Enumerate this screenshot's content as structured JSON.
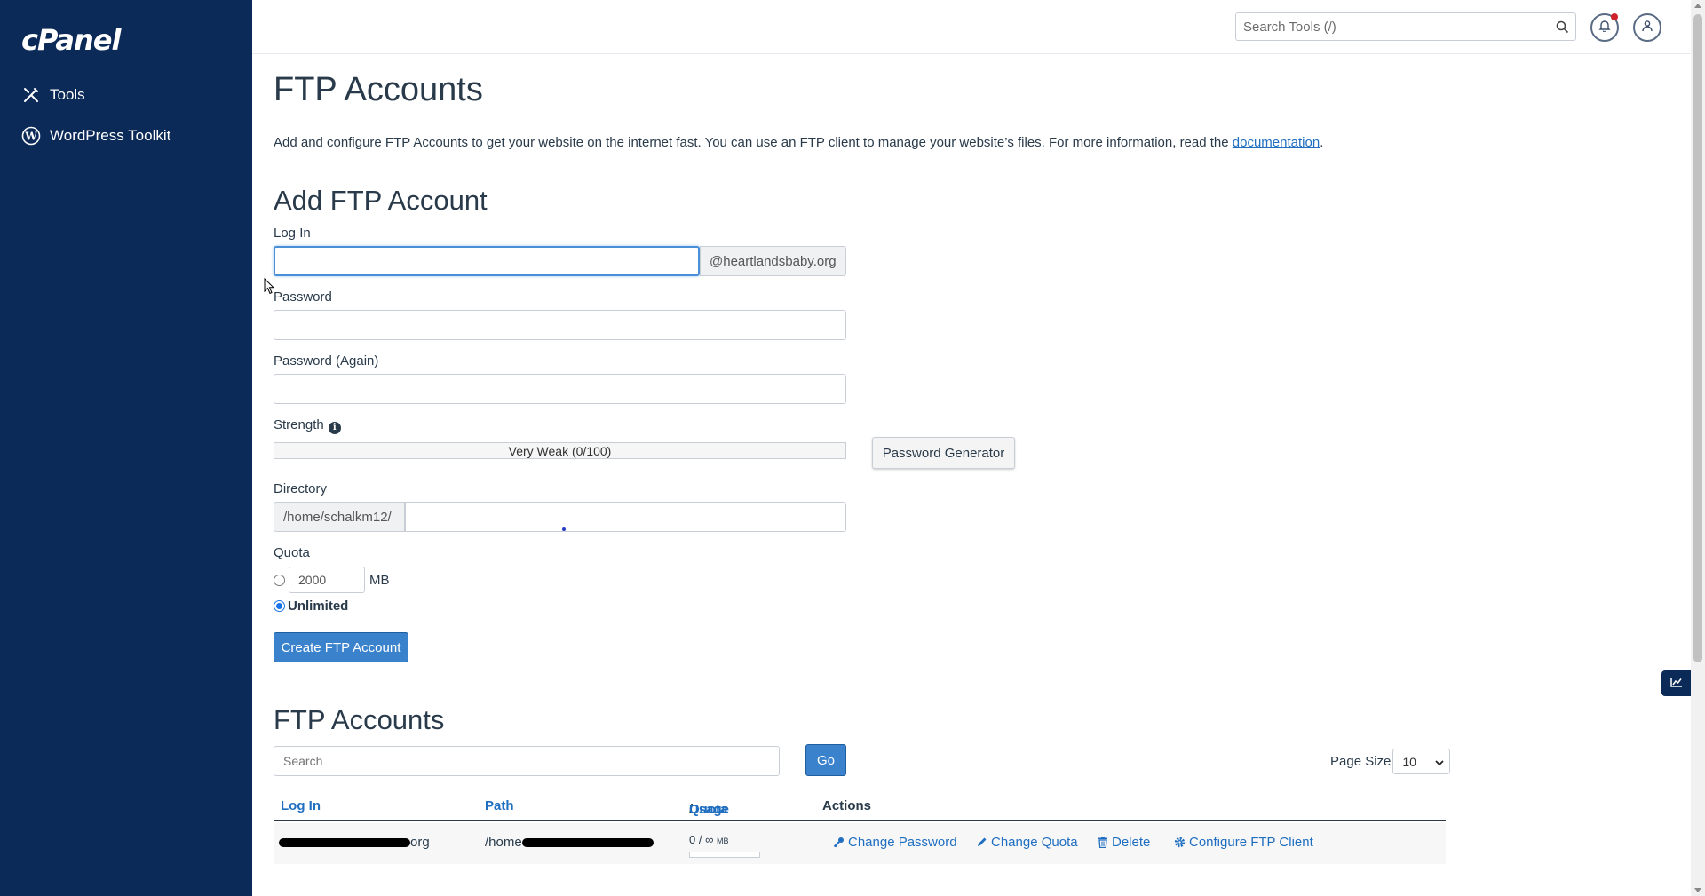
{
  "sidebar": {
    "logo": "cPanel",
    "items": [
      {
        "label": "Tools",
        "icon": "tools-icon"
      },
      {
        "label": "WordPress Toolkit",
        "icon": "wordpress-icon"
      }
    ]
  },
  "header": {
    "search_placeholder": "Search Tools (/)"
  },
  "page": {
    "title": "FTP Accounts",
    "intro": "Add and configure FTP Accounts to get your website on the internet fast. You can use an FTP client to manage your website’s files. For more information, read the ",
    "intro_link": "documentation",
    "intro_end": "."
  },
  "add_form": {
    "heading": "Add FTP Account",
    "login_label": "Log In",
    "login_value": "",
    "domain_suffix": "@heartlandsbaby.org",
    "password_label": "Password",
    "password_again_label": "Password (Again)",
    "strength_label": "Strength",
    "strength_text": "Very Weak (0/100)",
    "strength_value": 0,
    "password_generator": "Password Generator",
    "directory_label": "Directory",
    "directory_prefix": "/home/schalkm12/",
    "directory_value": "",
    "quota_label": "Quota",
    "quota_value": "2000",
    "quota_unit": "MB",
    "unlimited_label": "Unlimited",
    "quota_selected": "unlimited",
    "create_button": "Create FTP Account"
  },
  "accounts_list": {
    "heading": "FTP Accounts",
    "search_placeholder": "Search",
    "go_button": "Go",
    "page_size_label": "Page Size",
    "page_size_value": "10",
    "columns": {
      "login": "Log In",
      "path": "Path",
      "usage": "Usage",
      "separator": " / ",
      "quota": "Quota",
      "actions": "Actions"
    },
    "rows": [
      {
        "login_visible": "org",
        "path_visible": "/home",
        "usage": "0 / ∞",
        "usage_unit": "MB",
        "usage_fraction": 0,
        "actions": [
          "Change Password",
          "Change Quota",
          "Delete",
          "Configure FTP Client"
        ]
      }
    ]
  },
  "colors": {
    "sidebar_bg": "#0c2a57",
    "primary_button": "#3a82cc",
    "link": "#1f6ec0",
    "notification_dot": "#d0202a"
  }
}
